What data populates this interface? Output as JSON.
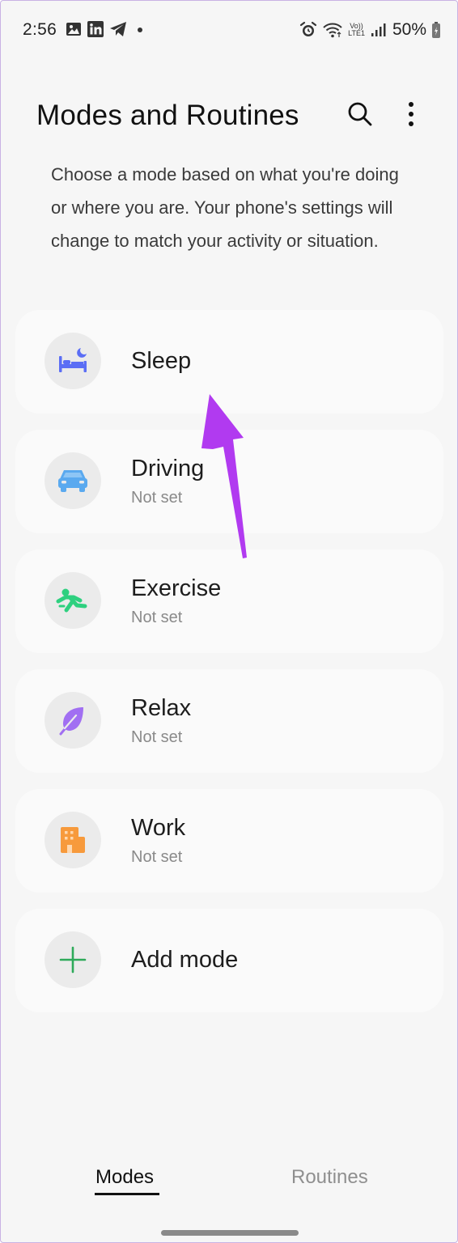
{
  "status_bar": {
    "time": "2:56",
    "battery": "50%",
    "network_label": "LTE1",
    "volte_label": "Vo))"
  },
  "header": {
    "title": "Modes and Routines"
  },
  "description": "Choose a mode based on what you're doing or where you are. Your phone's settings will change to match your activity or situation.",
  "modes": [
    {
      "name": "Sleep",
      "status": "",
      "icon": "bed-icon",
      "color": "#5b6ef5"
    },
    {
      "name": "Driving",
      "status": "Not set",
      "icon": "car-icon",
      "color": "#5aa9ef"
    },
    {
      "name": "Exercise",
      "status": "Not set",
      "icon": "running-icon",
      "color": "#2ed07f"
    },
    {
      "name": "Relax",
      "status": "Not set",
      "icon": "leaf-icon",
      "color": "#a16ff2"
    },
    {
      "name": "Work",
      "status": "Not set",
      "icon": "building-icon",
      "color": "#f79a3c"
    }
  ],
  "add_mode": {
    "label": "Add mode",
    "icon": "plus-icon",
    "color": "#2eaa5a"
  },
  "tabs": [
    {
      "label": "Modes",
      "active": true
    },
    {
      "label": "Routines",
      "active": false
    }
  ],
  "annotation": {
    "icon": "arrow-icon",
    "color": "#b13af0"
  }
}
